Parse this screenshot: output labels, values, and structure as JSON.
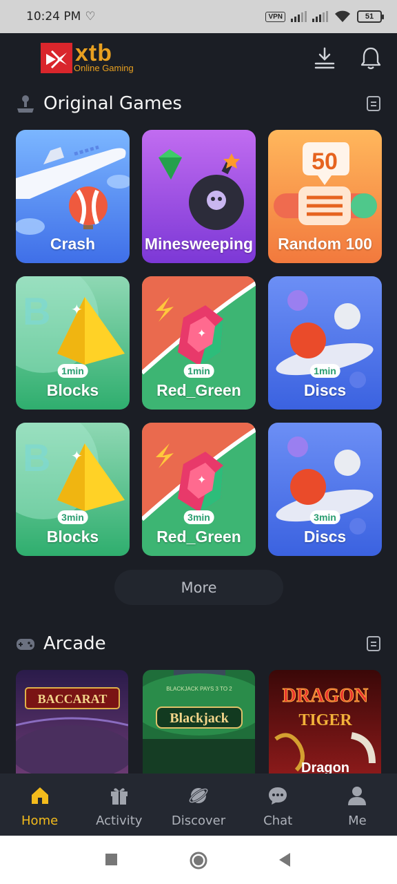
{
  "status_bar": {
    "time": "10:24 PM",
    "vpn": "VPN",
    "battery": "51"
  },
  "header": {
    "brand": "xtb",
    "brand_sub": "Online Gaming"
  },
  "sections": {
    "original": {
      "title": "Original Games"
    },
    "arcade": {
      "title": "Arcade"
    }
  },
  "games": [
    {
      "label": "Crash"
    },
    {
      "label": "Minesweeping"
    },
    {
      "label": "Random 100",
      "badge_number": "50"
    },
    {
      "label": "Blocks",
      "badge": "1min"
    },
    {
      "label": "Red_Green",
      "badge": "1min"
    },
    {
      "label": "Discs",
      "badge": "1min"
    },
    {
      "label": "Blocks",
      "badge": "3min"
    },
    {
      "label": "Red_Green",
      "badge": "3min"
    },
    {
      "label": "Discs",
      "badge": "3min"
    }
  ],
  "more_label": "More",
  "arcade": [
    {
      "label": "BACCARAT"
    },
    {
      "label": "Blackjack",
      "sub": "BLACKJACK PAYS 3 TO 2"
    },
    {
      "label": "DRAGON",
      "label2": "TIGER",
      "label3": "Dragon"
    }
  ],
  "nav": [
    {
      "label": "Home",
      "icon": "home-icon",
      "active": true
    },
    {
      "label": "Activity",
      "icon": "gift-icon"
    },
    {
      "label": "Discover",
      "icon": "planet-icon"
    },
    {
      "label": "Chat",
      "icon": "chat-icon"
    },
    {
      "label": "Me",
      "icon": "user-icon"
    }
  ],
  "colors": {
    "background": "#1b1e25",
    "accent": "#f3bb1c",
    "brand_red": "#d9262c",
    "brand_gold": "#e8a020"
  }
}
